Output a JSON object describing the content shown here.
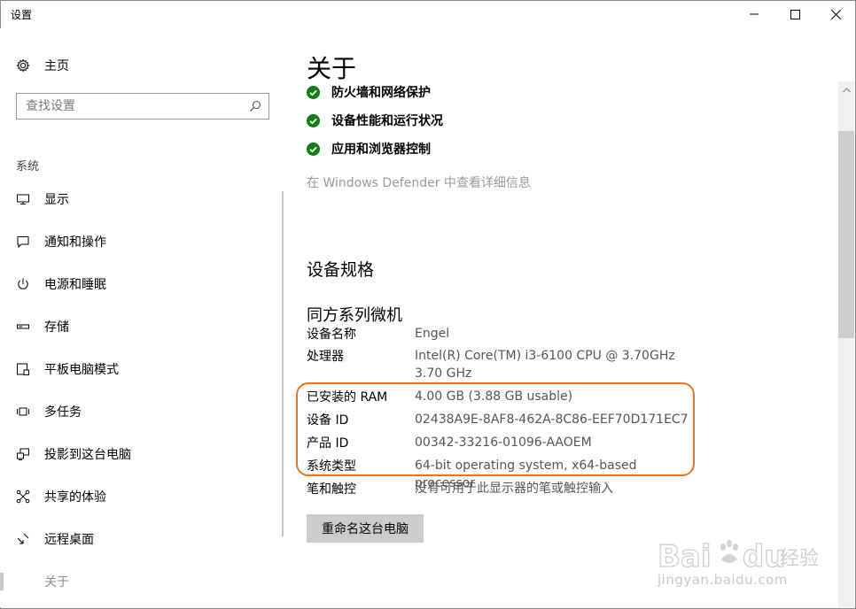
{
  "window": {
    "title": "设置"
  },
  "sidebar": {
    "home_label": "主页",
    "search": {
      "placeholder": "查找设置"
    },
    "section_label": "系统",
    "items": [
      {
        "label": "显示",
        "icon": "monitor-icon"
      },
      {
        "label": "通知和操作",
        "icon": "notification-icon"
      },
      {
        "label": "电源和睡眠",
        "icon": "power-icon"
      },
      {
        "label": "存储",
        "icon": "storage-icon"
      },
      {
        "label": "平板电脑模式",
        "icon": "tablet-mode-icon"
      },
      {
        "label": "多任务",
        "icon": "multitasking-icon"
      },
      {
        "label": "投影到这台电脑",
        "icon": "project-icon"
      },
      {
        "label": "共享的体验",
        "icon": "shared-experience-icon"
      },
      {
        "label": "远程桌面",
        "icon": "remote-desktop-icon"
      },
      {
        "label": "关于",
        "icon": "info-icon",
        "active": true
      }
    ]
  },
  "main": {
    "title": "关于",
    "security_items": [
      "防火墙和网络保护",
      "设备性能和运行状况",
      "应用和浏览器控制"
    ],
    "defender_link": "在 Windows Defender 中查看详细信息",
    "spec_heading": "设备规格",
    "device_model": "同方系列微机",
    "specs": [
      {
        "key": "设备名称",
        "value": "Engel"
      },
      {
        "key": "处理器",
        "value": "Intel(R) Core(TM) i3-6100 CPU @ 3.70GHz   3.70 GHz"
      },
      {
        "key": "已安装的 RAM",
        "value": "4.00 GB (3.88 GB usable)"
      },
      {
        "key": "设备 ID",
        "value": "02438A9E-8AF8-462A-8C86-EEF70D171EC7"
      },
      {
        "key": "产品 ID",
        "value": "00342-33216-01096-AAOEM"
      },
      {
        "key": "系统类型",
        "value": "64-bit operating system, x64-based processor"
      },
      {
        "key": "笔和触控",
        "value": "没有可用于此显示器的笔或触控输入"
      }
    ],
    "rename_button": "重命名这台电脑"
  },
  "watermark": {
    "brand": "Bai du 经验",
    "sub": "jingyan.baidu.com"
  },
  "colors": {
    "check_green": "#107c10",
    "highlight": "#e8741f"
  }
}
